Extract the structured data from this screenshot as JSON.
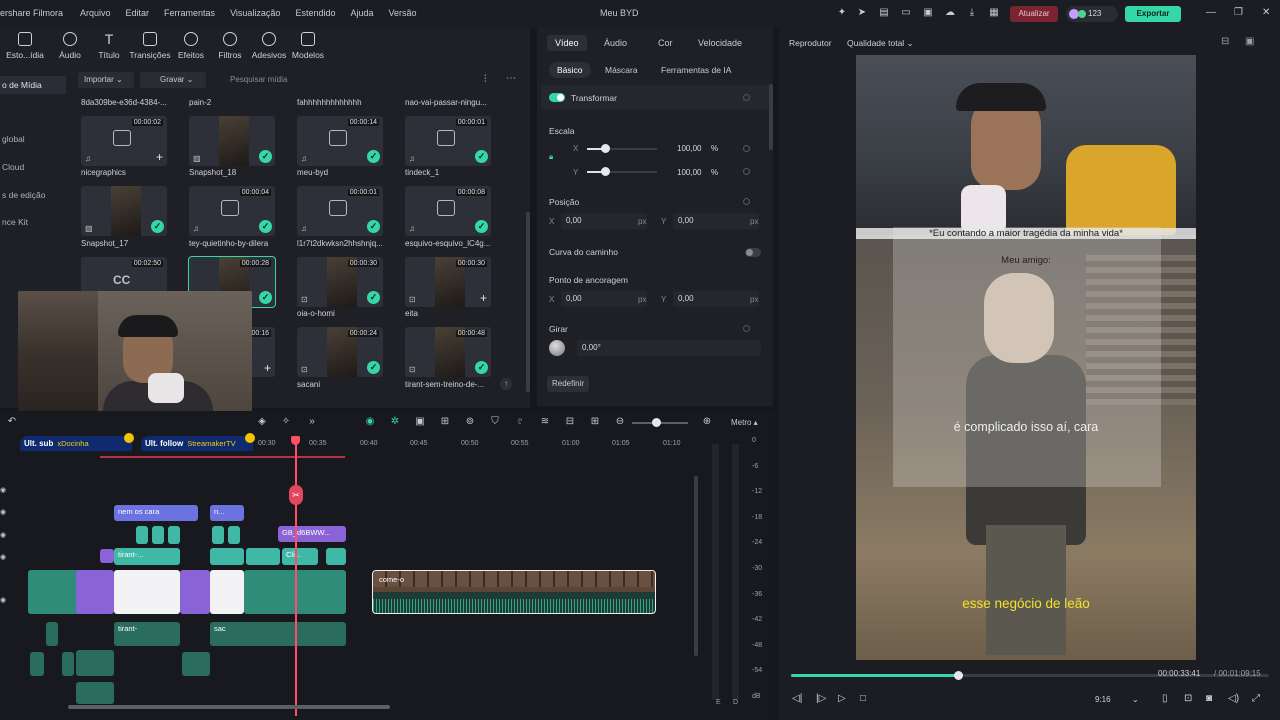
{
  "titlebar": {
    "brand": "ershare Filmora",
    "menus": [
      "Arquivo",
      "Editar",
      "Ferramentas",
      "Visualização",
      "Estendido",
      "Ajuda",
      "Versão"
    ],
    "doc_title": "Meu BYD",
    "update_label": "Atualizar",
    "credits": "123",
    "export_label": "Exportar",
    "accent": "#35d7a6"
  },
  "toolbar": {
    "items": [
      "Esto...ídia",
      "Áudio",
      "Título",
      "Transições",
      "Efeitos",
      "Filtros",
      "Adesivos",
      "Modelos"
    ]
  },
  "sidebar": {
    "items": [
      "o de Mídia",
      "global",
      "Cloud",
      "s de edição",
      "nce Kit"
    ]
  },
  "media_bar": {
    "import_label": "Importar",
    "record_label": "Gravar",
    "search_placeholder": "Pesquisar mídia"
  },
  "media": {
    "top_labels": [
      "8da309be-e36d-4384-...",
      "pain-2",
      "fahhhhhhhhhhhhh",
      "nao-vai-passar-ningu..."
    ],
    "row1": [
      {
        "label": "nicegraphics",
        "dur": "00:00:02"
      },
      {
        "label": "Snapshot_18",
        "dur": ""
      },
      {
        "label": "meu-byd",
        "dur": "00:00:14"
      },
      {
        "label": "tindeck_1",
        "dur": "00:00:01"
      }
    ],
    "row2": [
      {
        "label": "Snapshot_17",
        "dur": ""
      },
      {
        "label": "tey-quietinho-by-dilera",
        "dur": "00:00:04"
      },
      {
        "label": "l1r7t2dkwksn2hhshnjq...",
        "dur": "00:00:01"
      },
      {
        "label": "esquivo-esquivo_lC4g...",
        "dur": "00:00:08"
      }
    ],
    "row3": [
      {
        "label": "",
        "dur": "00:02:50",
        "badge": "CC"
      },
      {
        "label": "",
        "dur": "00:00:28"
      },
      {
        "label": "oia-o-homi",
        "dur": "00:00:30"
      },
      {
        "label": "eita",
        "dur": "00:00:30"
      }
    ],
    "row4": [
      {
        "label": "",
        "dur": ""
      },
      {
        "label": "",
        "dur": "00:00:16"
      },
      {
        "label": "sacani",
        "dur": "00:00:24"
      },
      {
        "label": "tirant-sem-treino-de-...",
        "dur": "00:00:48"
      }
    ]
  },
  "props": {
    "tabs": [
      "Vídeo",
      "Áudio",
      "Cor",
      "Velocidade"
    ],
    "subtabs": [
      "Básico",
      "Máscara",
      "Ferramentas de IA"
    ],
    "transform_label": "Transformar",
    "scale_label": "Escala",
    "x_label": "X",
    "y_label": "Y",
    "scale_x": "100,00",
    "scale_y": "100,00",
    "percent": "%",
    "position_label": "Posição",
    "pos_x": "0,00",
    "pos_y": "0,00",
    "px": "px",
    "path_curve_label": "Curva do caminho",
    "anchor_label": "Ponto de ancoragem",
    "anchor_x": "0,00",
    "anchor_y": "0,00",
    "rotate_label": "Girar",
    "rotate_value": "0,00°",
    "reset_label": "Redefinir"
  },
  "player": {
    "title": "Reprodutor",
    "quality": "Qualidade total",
    "caption_top": "*Eu contando a maior tragédia da minha vida*",
    "caption_friend": "Meu amigo:",
    "caption_mid": "é complicado isso aí, cara",
    "caption_bottom": "esse negócio de leão",
    "time_current": "00:00:33:41",
    "time_total": "/ 00:01:09:15",
    "aspect": "9:16",
    "progress": 0.35
  },
  "timeline": {
    "metro_label": "Metro",
    "ruler": [
      "00:30",
      "00:35",
      "00:40",
      "00:45",
      "00:50",
      "00:55",
      "01:00",
      "01:05",
      "01:10"
    ],
    "ult_sub_label": "Ult. sub",
    "ult_sub_name": "xDocinha",
    "ult_follow_label": "Ult. follow",
    "ult_follow_name": "StreamakerTV",
    "clips": {
      "title1": "nem os cara",
      "title2": "n...",
      "purple": "GB_d6BWW...",
      "teal1": "tirant-...",
      "teal2": "Cli...",
      "selected": "come-o",
      "audio1": "tirant-",
      "audio2": "sac"
    },
    "meter_ticks": [
      "0",
      "-6",
      "-12",
      "-18",
      "-24",
      "-30",
      "-36",
      "-42",
      "-48",
      "-54",
      "dB"
    ],
    "meter_lr": [
      "E",
      "D"
    ]
  }
}
